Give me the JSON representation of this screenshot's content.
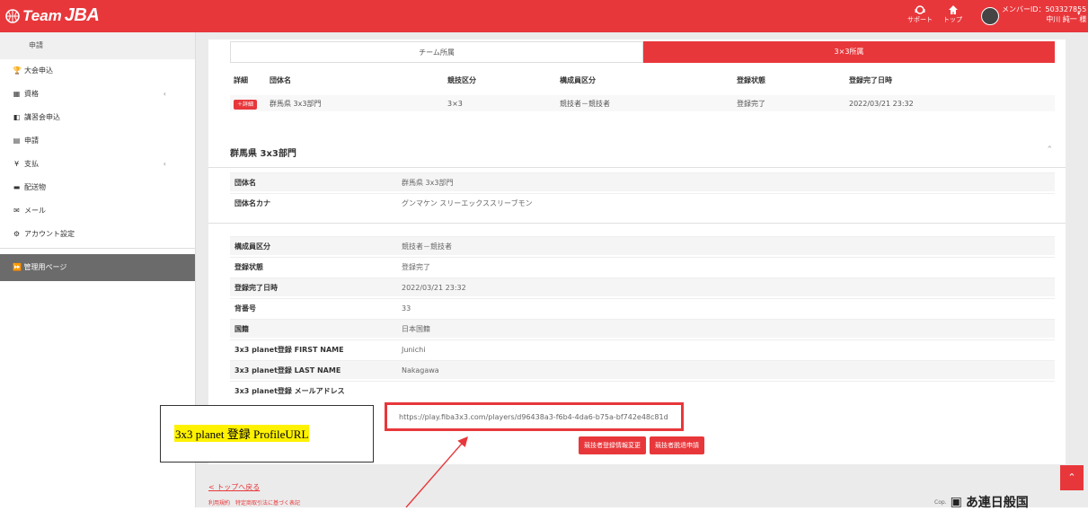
{
  "header": {
    "logo_prefix": "Team",
    "logo_suffix": "JBA",
    "support_label": "サポート",
    "top_label": "トップ",
    "member_id": "メンバーID：503327855",
    "member_name": "中川 純一 様",
    "brand_color": "#e8373b"
  },
  "sidebar": {
    "head": "申請",
    "items": [
      {
        "icon": "trophy-icon",
        "glyph": "🏆",
        "label": "大会申込"
      },
      {
        "icon": "id-card-icon",
        "glyph": "▦",
        "label": "資格",
        "chevron": "‹"
      },
      {
        "icon": "class-icon",
        "glyph": "◧",
        "label": "講習会申込"
      },
      {
        "icon": "document-icon",
        "glyph": "▤",
        "label": "申請"
      },
      {
        "icon": "yen-icon",
        "glyph": "¥",
        "label": "支払",
        "chevron": "‹"
      },
      {
        "icon": "truck-icon",
        "glyph": "▬",
        "label": "配送物"
      },
      {
        "icon": "mail-icon",
        "glyph": "✉",
        "label": "メール"
      },
      {
        "icon": "account-settings-icon",
        "glyph": "⚙",
        "label": "アカウント設定"
      }
    ],
    "admin_label": "管理用ページ"
  },
  "tabs": {
    "team": "チーム所属",
    "three_x_three": "3×3所属"
  },
  "affiliation_table": {
    "headers": [
      "詳細",
      "団体名",
      "競技区分",
      "構成員区分",
      "登録状態",
      "登録完了日時"
    ],
    "row": {
      "detail_button": "＋詳細",
      "org": "群馬県 3x3部門",
      "category": "3×3",
      "member_type": "競技者－競技者",
      "status": "登録完了",
      "completed": "2022/03/21 23:32"
    }
  },
  "detail": {
    "title": "群馬県 3x3部門",
    "rows_group1": [
      {
        "label": "団体名",
        "value": "群馬県 3x3部門"
      },
      {
        "label": "団体名カナ",
        "value": "グンマケン スリーエックススリーブモン"
      }
    ],
    "rows_group2": [
      {
        "label": "構成員区分",
        "value": "競技者－競技者"
      },
      {
        "label": "登録状態",
        "value": "登録完了"
      },
      {
        "label": "登録完了日時",
        "value": "2022/03/21 23:32"
      },
      {
        "label": "背番号",
        "value": "33"
      },
      {
        "label": "国籍",
        "value": "日本国籍"
      },
      {
        "label": "3x3 planet登録 FIRST NAME",
        "value": "Junichi"
      },
      {
        "label": "3x3 planet登録 LAST NAME",
        "value": "Nakagawa"
      },
      {
        "label": "3x3 planet登録 メールアドレス",
        "value": ""
      }
    ],
    "profile_url": "https://play.fiba3x3.com/players/d96438a3-f6b4-4da6-b75a-bf742e48c81d",
    "buttons": {
      "change": "競技者登録情報変更",
      "withdraw": "競技者脱退申請"
    }
  },
  "footer": {
    "back_link": "< トップへ戻る",
    "small_links": "利用規約　特定商取引法に基づく表記",
    "seal_text": "あ連日般国"
  },
  "annotation": {
    "callout_text": "3x3 planet 登録  ProfileURL"
  }
}
